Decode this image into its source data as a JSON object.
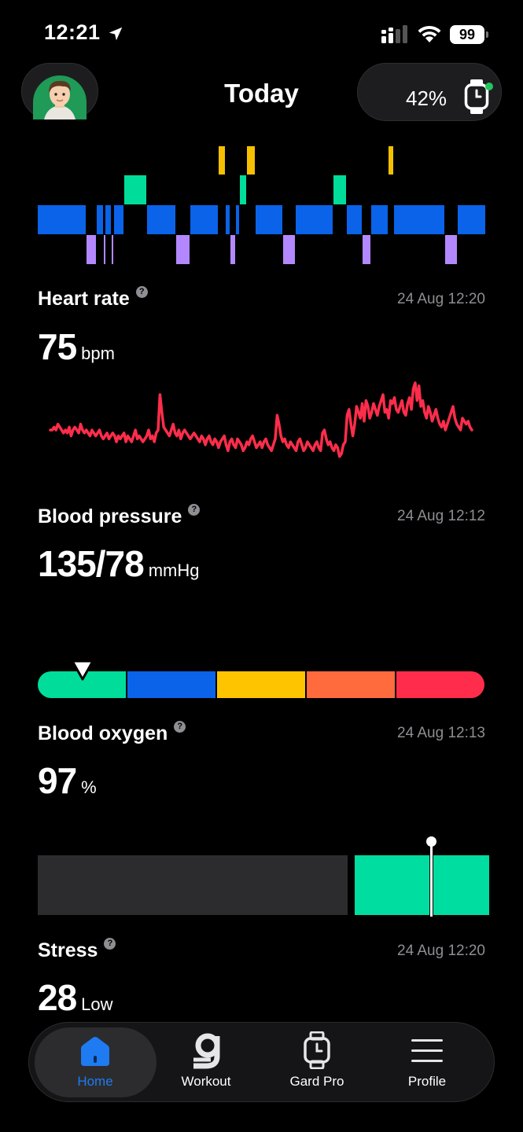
{
  "status_bar": {
    "time": "12:21",
    "battery": "99"
  },
  "header": {
    "title": "Today",
    "watch_battery": "42%"
  },
  "sleep_chart": {
    "stages": [
      "awake",
      "rem",
      "light",
      "deep"
    ],
    "colors": {
      "awake": "#f5c000",
      "rem": "#00dd9a",
      "light": "#0a63e8",
      "deep": "#b388ff"
    },
    "segments": [
      [
        "light",
        0,
        62
      ],
      [
        "deep",
        62,
        75
      ],
      [
        "light",
        75,
        84
      ],
      [
        "deep",
        84,
        86
      ],
      [
        "light",
        86,
        94
      ],
      [
        "deep",
        94,
        97
      ],
      [
        "light",
        97,
        110
      ],
      [
        "rem",
        110,
        139
      ],
      [
        "light",
        139,
        176
      ],
      [
        "deep",
        176,
        194
      ],
      [
        "light",
        194,
        230
      ],
      [
        "awake",
        230,
        239
      ],
      [
        "light",
        239,
        245
      ],
      [
        "deep",
        245,
        252
      ],
      [
        "light",
        252,
        257
      ],
      [
        "rem",
        257,
        266
      ],
      [
        "awake",
        266,
        277
      ],
      [
        "light",
        277,
        312
      ],
      [
        "deep",
        312,
        328
      ],
      [
        "light",
        328,
        376
      ],
      [
        "rem",
        376,
        393
      ],
      [
        "light",
        393,
        413
      ],
      [
        "deep",
        413,
        424
      ],
      [
        "light",
        424,
        446
      ],
      [
        "awake",
        446,
        453
      ],
      [
        "light",
        453,
        518
      ],
      [
        "deep",
        518,
        534
      ],
      [
        "light",
        534,
        570
      ]
    ]
  },
  "heart_rate": {
    "title": "Heart rate",
    "timestamp": "24 Aug 12:20",
    "value": "75",
    "unit": "bpm",
    "color": "#ff2d4b",
    "series": [
      70,
      70,
      71,
      70,
      72,
      71,
      70,
      69,
      70,
      69,
      71,
      68,
      70,
      71,
      70,
      69,
      72,
      70,
      69,
      70,
      69,
      68,
      70,
      69,
      68,
      69,
      70,
      68,
      67,
      68,
      69,
      67,
      68,
      69,
      68,
      66,
      68,
      67,
      68,
      69,
      66,
      68,
      67,
      66,
      68,
      70,
      67,
      68,
      67,
      66,
      67,
      68,
      70,
      67,
      68,
      66,
      69,
      70,
      82,
      76,
      71,
      70,
      69,
      68,
      70,
      72,
      69,
      68,
      70,
      67,
      69,
      70,
      69,
      68,
      67,
      68,
      69,
      68,
      67,
      66,
      68,
      67,
      65,
      67,
      68,
      66,
      65,
      67,
      66,
      64,
      66,
      67,
      68,
      65,
      63,
      66,
      67,
      65,
      64,
      67,
      66,
      65,
      63,
      64,
      66,
      65,
      67,
      68,
      66,
      64,
      65,
      66,
      64,
      66,
      67,
      65,
      64,
      63,
      65,
      67,
      75,
      72,
      68,
      66,
      67,
      65,
      64,
      66,
      65,
      64,
      63,
      66,
      67,
      65,
      63,
      64,
      66,
      65,
      64,
      63,
      65,
      66,
      64,
      63,
      69,
      70,
      67,
      65,
      66,
      64,
      63,
      65,
      64,
      61,
      62,
      65,
      66,
      75,
      77,
      72,
      68,
      72,
      78,
      76,
      74,
      79,
      73,
      80,
      78,
      74,
      76,
      79,
      77,
      75,
      78,
      80,
      82,
      76,
      77,
      74,
      80,
      79,
      81,
      77,
      76,
      78,
      80,
      76,
      75,
      79,
      81,
      77,
      84,
      86,
      80,
      85,
      78,
      80,
      76,
      74,
      78,
      76,
      73,
      75,
      77,
      74,
      72,
      71,
      73,
      70,
      72,
      74,
      76,
      78,
      74,
      72,
      71,
      70,
      74,
      73,
      72,
      73,
      71,
      70
    ]
  },
  "blood_pressure": {
    "title": "Blood pressure",
    "timestamp": "24 Aug 12:12",
    "value": "135/78",
    "unit": "mmHg",
    "zones": [
      "#00dd9a",
      "#0a63e8",
      "#ffc400",
      "#ff6b3d",
      "#ff2d4b"
    ],
    "marker_position": 0.1
  },
  "blood_oxygen": {
    "title": "Blood oxygen",
    "timestamp": "24 Aug 12:13",
    "value": "97",
    "unit": "%",
    "low_color": "#2c2c2e",
    "normal_color": "#00dda0"
  },
  "stress": {
    "title": "Stress",
    "timestamp": "24 Aug 12:20",
    "value": "28",
    "level": "Low"
  },
  "tabbar": {
    "items": [
      {
        "label": "Home",
        "icon": "home-icon",
        "active": true,
        "color": "#1e7bf2"
      },
      {
        "label": "Workout",
        "icon": "workout-icon",
        "active": false
      },
      {
        "label": "Gard Pro",
        "icon": "watch-icon",
        "active": false
      },
      {
        "label": "Profile",
        "icon": "menu-icon",
        "active": false
      }
    ]
  }
}
